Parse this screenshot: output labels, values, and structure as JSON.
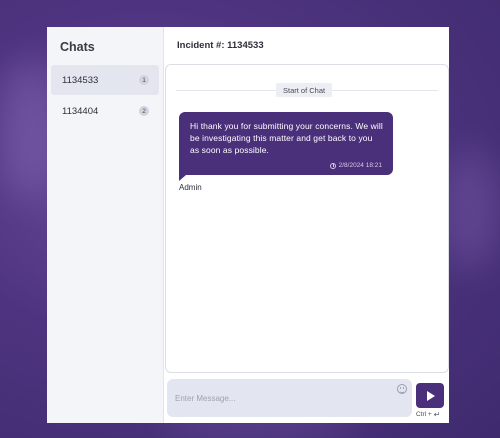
{
  "sidebar": {
    "title": "Chats",
    "items": [
      {
        "label": "1134533",
        "badge": "1",
        "active": true
      },
      {
        "label": "1134404",
        "badge": "2",
        "active": false
      }
    ]
  },
  "header": {
    "title": "Incident #: 1134533"
  },
  "conversation": {
    "start_label": "Start of Chat",
    "messages": [
      {
        "text": "Hi thank you for submitting your concerns. We will be investigating this matter and get back to you as soon as possible.",
        "timestamp": "2/8/2024 18:21",
        "sender": "Admin"
      }
    ]
  },
  "composer": {
    "placeholder": "Enter Message...",
    "shortcut": "Ctrl +",
    "send_icon": "send-icon",
    "emoji_icon": "emoji-icon"
  },
  "colors": {
    "accent": "#4a2f7a",
    "background": "#4e3480",
    "input_bg": "#e3e5f0"
  }
}
